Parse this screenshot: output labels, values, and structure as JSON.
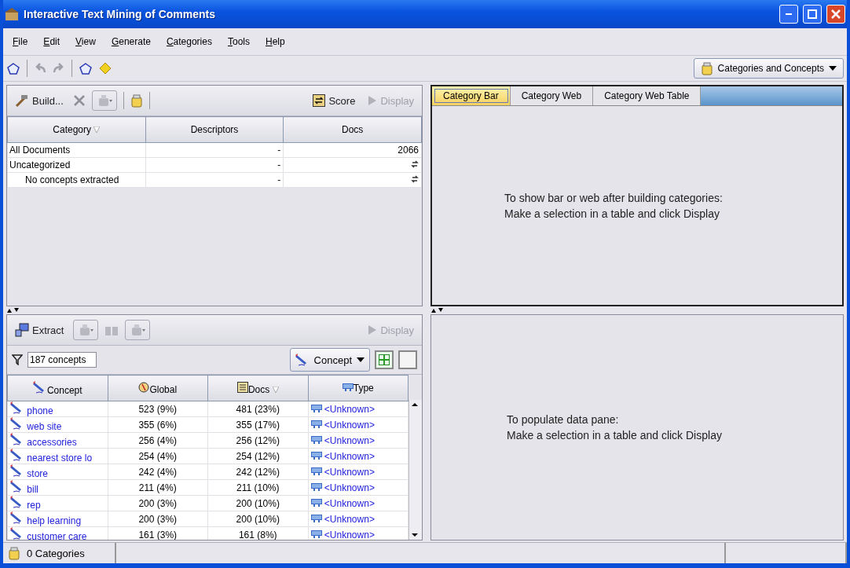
{
  "window": {
    "title": "Interactive Text Mining of Comments"
  },
  "menu": [
    "File",
    "Edit",
    "View",
    "Generate",
    "Categories",
    "Tools",
    "Help"
  ],
  "view_selector": {
    "label": "Categories and Concepts"
  },
  "categories_panel": {
    "toolbar": {
      "build": "Build...",
      "score": "Score",
      "display": {
        "label": "Display",
        "disabled": true
      }
    },
    "columns": [
      "Category",
      "Descriptors",
      "Docs"
    ],
    "rows": [
      {
        "category": "All Documents",
        "descriptors": "-",
        "docs": "2066",
        "docs_pending": false
      },
      {
        "category": "Uncategorized",
        "descriptors": "-",
        "docs_pending": true,
        "children": [
          {
            "category": "No concepts extracted",
            "descriptors": "-",
            "docs_pending": true
          }
        ]
      }
    ]
  },
  "concepts_panel": {
    "toolbar": {
      "extract": "Extract",
      "display": {
        "label": "Display",
        "disabled": true
      }
    },
    "filter": {
      "value": "187 concepts"
    },
    "type_selector": {
      "label": "Concept"
    },
    "columns": [
      "Concept",
      "Global",
      "Docs",
      "Type"
    ],
    "rows": [
      {
        "concept": "phone",
        "global": "523 (9%)",
        "docs": "481 (23%)",
        "type": "<Unknown>"
      },
      {
        "concept": "web site",
        "global": "355 (6%)",
        "docs": "355 (17%)",
        "type": "<Unknown>"
      },
      {
        "concept": "accessories",
        "global": "256 (4%)",
        "docs": "256 (12%)",
        "type": "<Unknown>"
      },
      {
        "concept": "nearest store lo",
        "global": "254 (4%)",
        "docs": "254 (12%)",
        "type": "<Unknown>"
      },
      {
        "concept": "store",
        "global": "242 (4%)",
        "docs": "242 (12%)",
        "type": "<Unknown>"
      },
      {
        "concept": "bill",
        "global": "211 (4%)",
        "docs": "211 (10%)",
        "type": "<Unknown>"
      },
      {
        "concept": "rep",
        "global": "200 (3%)",
        "docs": "200 (10%)",
        "type": "<Unknown>"
      },
      {
        "concept": "help learning",
        "global": "200 (3%)",
        "docs": "200 (10%)",
        "type": "<Unknown>"
      },
      {
        "concept": "customer care",
        "global": "161 (3%)",
        "docs": "161 (8%)",
        "type": "<Unknown>"
      }
    ]
  },
  "visual_panel": {
    "tabs": [
      {
        "label": "Category Bar",
        "selected": true
      },
      {
        "label": "Category Web",
        "selected": false
      },
      {
        "label": "Category Web Table",
        "selected": false
      }
    ],
    "message": [
      "To show bar or web after building categories:",
      "Make a selection in a table and click Display"
    ]
  },
  "data_pane": {
    "message": [
      "To populate data pane:",
      "Make a selection in a table and click Display"
    ]
  },
  "status_bar": {
    "text": "0 Categories"
  }
}
